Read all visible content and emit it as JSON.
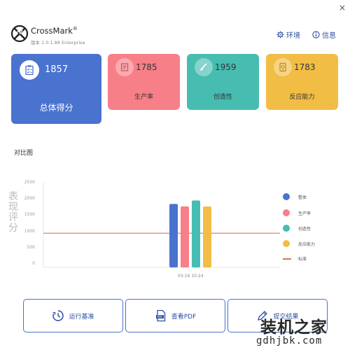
{
  "window": {
    "close_glyph": "×"
  },
  "app": {
    "name": "CrossMark",
    "trademark": "®",
    "version": "版本 1.0.1.88 Enterprise"
  },
  "header": {
    "env_label": "环境",
    "info_label": "信息"
  },
  "cards": {
    "overall": {
      "value": "1857",
      "label": "总体得分",
      "color": "#4a72cf"
    },
    "productivity": {
      "value": "1785",
      "label": "生产率",
      "color": "#f77f88"
    },
    "creativity": {
      "value": "1959",
      "label": "创造性",
      "color": "#46bdb0"
    },
    "responsiveness": {
      "value": "1783",
      "label": "反应能力",
      "color": "#f2bd45"
    }
  },
  "section": {
    "title": "对比图"
  },
  "chart_data": {
    "type": "bar",
    "ylabel": "表现评分",
    "ylim": [
      0,
      2500
    ],
    "yticks": [
      "2500",
      "2000",
      "1500",
      "1000",
      "500",
      "0"
    ],
    "categories": [
      "03-16 10:24"
    ],
    "series": [
      {
        "name": "整体",
        "values": [
          1857
        ],
        "color": "#4a72cf"
      },
      {
        "name": "生产率",
        "values": [
          1785
        ],
        "color": "#f77f88"
      },
      {
        "name": "创造性",
        "values": [
          1959
        ],
        "color": "#46bdb0"
      },
      {
        "name": "反应能力",
        "values": [
          1783
        ],
        "color": "#f2bd45"
      }
    ],
    "baseline": {
      "name": "标准",
      "value": 1000,
      "color": "#e86a62"
    },
    "legend": "right"
  },
  "buttons": {
    "run": "运行基准",
    "view_pdf": "查看PDF",
    "submit": "提交结果"
  },
  "watermark": {
    "text_cn": "装机之家",
    "url": "gdhjbk.com"
  }
}
